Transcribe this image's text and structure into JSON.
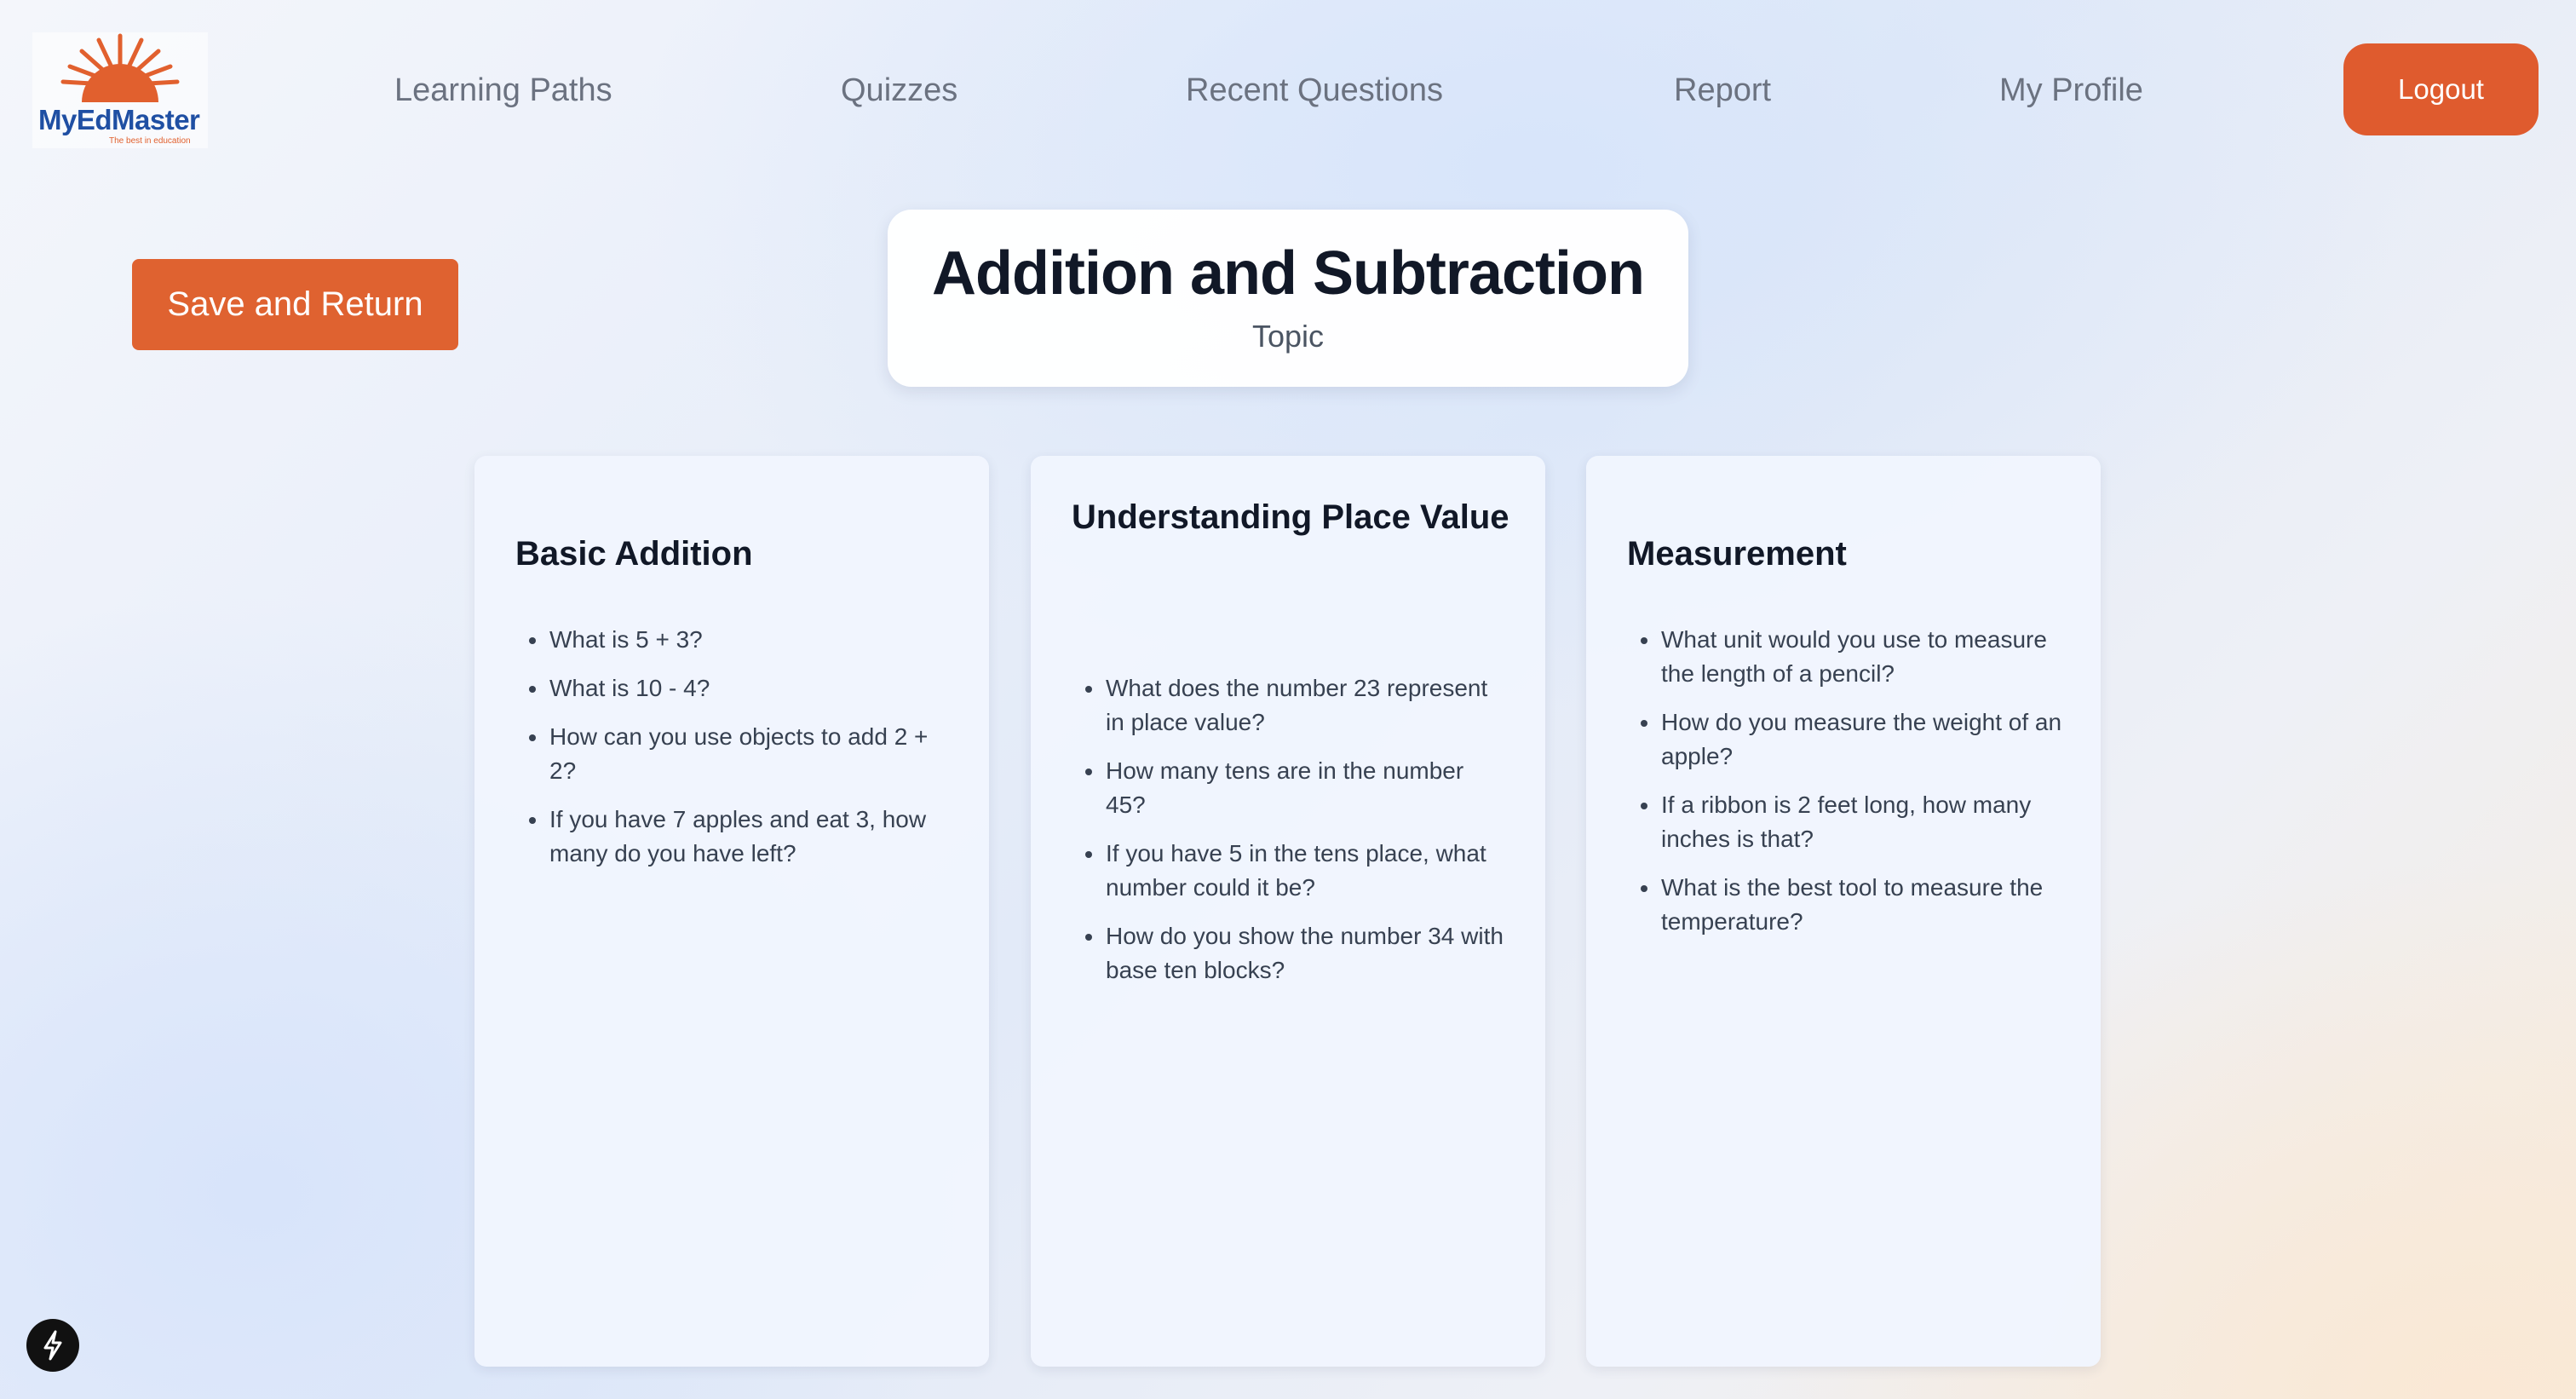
{
  "logo": {
    "brand": "MyEdMaster",
    "tagline": "The best in education"
  },
  "nav": {
    "items": [
      {
        "label": "Learning Paths"
      },
      {
        "label": "Quizzes"
      },
      {
        "label": "Recent Questions"
      },
      {
        "label": "Report"
      },
      {
        "label": "My Profile"
      }
    ],
    "logout_label": "Logout"
  },
  "actions": {
    "save_label": "Save and Return"
  },
  "topic": {
    "title": "Addition and Subtraction",
    "subtitle": "Topic"
  },
  "cards": [
    {
      "title": "Basic Addition",
      "questions": [
        "What is 5 + 3?",
        "What is 10 - 4?",
        "How can you use objects to add 2 + 2?",
        "If you have 7 apples and eat 3, how many do you have left?"
      ]
    },
    {
      "title": "Understanding Place Value",
      "questions": [
        "What does the number 23 represent in place value?",
        "How many tens are in the number 45?",
        "If you have 5 in the tens place, what number could it be?",
        "How do you show the number 34 with base ten blocks?"
      ]
    },
    {
      "title": "Measurement",
      "questions": [
        "What unit would you use to measure the length of a pencil?",
        "How do you measure the weight of an apple?",
        "If a ribbon is 2 feet long, how many inches is that?",
        "What is the best tool to measure the temperature?"
      ]
    }
  ],
  "colors": {
    "accent": "#df5b2e",
    "brand_blue": "#1f4fa3"
  },
  "icons": {
    "dev_tools": "lightning-bolt-icon"
  }
}
